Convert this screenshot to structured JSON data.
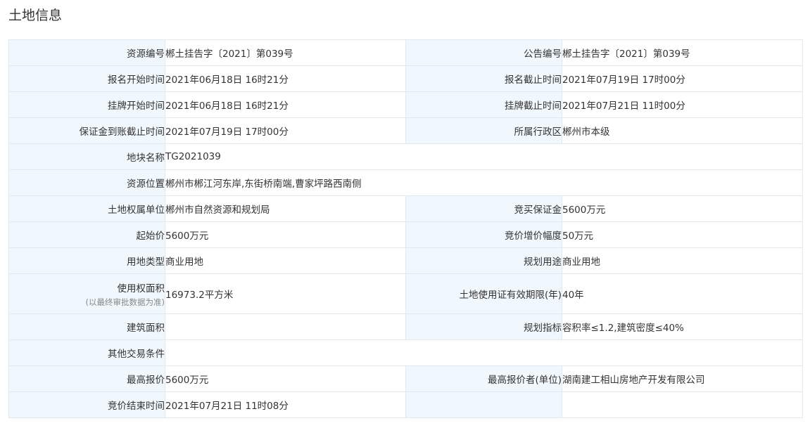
{
  "title": "土地信息",
  "rows": [
    {
      "l1": "资源编号",
      "v1": "郴土挂告字〔2021〕第039号",
      "l2": "公告编号",
      "v2": "郴土挂告字〔2021〕第039号"
    },
    {
      "l1": "报名开始时间",
      "v1": "2021年06月18日 16时21分",
      "l2": "报名截止时间",
      "v2": "2021年07月19日 17时00分"
    },
    {
      "l1": "挂牌开始时间",
      "v1": "2021年06月18日 16时21分",
      "l2": "挂牌截止时间",
      "v2": "2021年07月21日 11时00分"
    },
    {
      "l1": "保证金到账截止时间",
      "v1": "2021年07月19日 17时00分",
      "l2": "所属行政区",
      "v2": "郴州市本级"
    },
    {
      "l1": "地块名称",
      "v1": "TG2021039"
    },
    {
      "l1": "资源位置",
      "v1": "郴州市郴江河东岸,东街桥南端,曹家坪路西南侧"
    },
    {
      "l1": "土地权属单位",
      "v1": "郴州市自然资源和规划局",
      "l2": "竞买保证金",
      "v2": "5600万元"
    },
    {
      "l1": "起始价",
      "v1": "5600万元",
      "l2": "竞价增价幅度",
      "v2": "50万元"
    },
    {
      "l1": "用地类型",
      "v1": "商业用地",
      "l2": "规划用途",
      "v2": "商业用地"
    },
    {
      "l1": "使用权面积",
      "l1_note": "(以最终审批数据为准)",
      "v1": "16973.2平方米",
      "l2": "土地使用证有效期限(年)",
      "v2": "40年"
    },
    {
      "l1": "建筑面积",
      "v1": "",
      "l2": "规划指标",
      "v2": "容积率≤1.2,建筑密度≤40%"
    },
    {
      "l1": "其他交易条件",
      "v1": ""
    },
    {
      "l1": "最高报价",
      "v1": "5600万元",
      "l2": "最高报价者(单位)",
      "v2": "湖南建工相山房地产开发有限公司"
    },
    {
      "l1": "竞价结束时间",
      "v1": "2021年07月21日 11时08分",
      "l2": "",
      "v2": ""
    }
  ]
}
